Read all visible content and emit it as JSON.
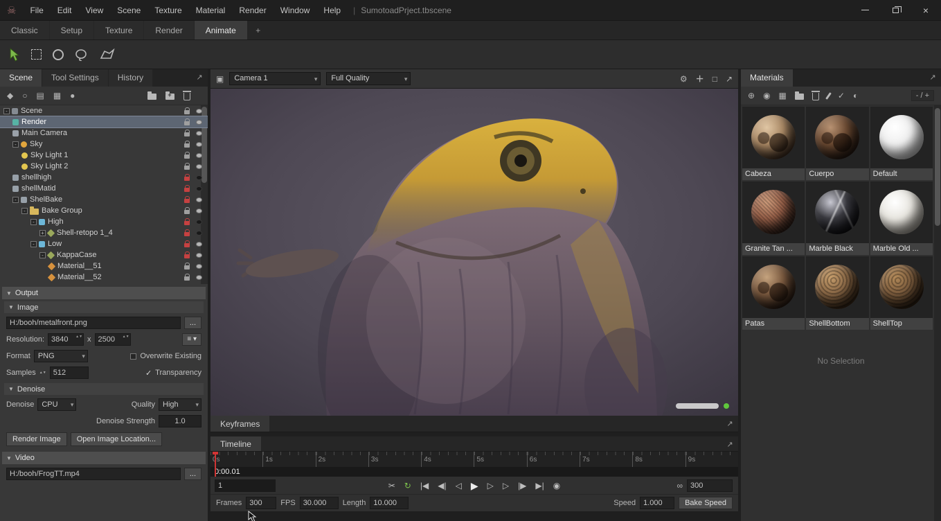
{
  "titlebar": {
    "menu": [
      "File",
      "Edit",
      "View",
      "Scene",
      "Texture",
      "Material",
      "Render",
      "Window",
      "Help"
    ],
    "separator": "|",
    "document": "SumotoadPrject.tbscene"
  },
  "workspace_tabs": {
    "items": [
      "Classic",
      "Setup",
      "Texture",
      "Render",
      "Animate"
    ],
    "active": "Animate",
    "add_button": "+"
  },
  "left_panel": {
    "tabs": [
      "Scene",
      "Tool Settings",
      "History"
    ],
    "active_tab": "Scene",
    "toolbar_icons": [
      {
        "n": "add-object-icon",
        "g": "◆"
      },
      {
        "n": "add-light-icon",
        "g": "○"
      },
      {
        "n": "add-backdrop-icon",
        "g": "▤"
      },
      {
        "n": "add-external-object-icon",
        "g": "▦"
      },
      {
        "n": "add-turntable-icon",
        "g": "●"
      },
      {
        "n": "new-folder-icon",
        "g": "folder"
      },
      {
        "n": "add-to-folder-icon",
        "g": "folder+"
      },
      {
        "n": "delete-object-icon",
        "g": "trash"
      }
    ],
    "tree": [
      {
        "l": "Scene",
        "d": 0,
        "c": "#858b92",
        "s": "sq",
        "exp": "-",
        "lock": "g",
        "eye": 1
      },
      {
        "l": "Render",
        "d": 1,
        "c": "#57b3a5",
        "s": "sq",
        "lock": "g",
        "eye": 1,
        "sel": true
      },
      {
        "l": "Main Camera",
        "d": 1,
        "c": "#9aa1a9",
        "s": "sq",
        "lock": "g",
        "eye": 1
      },
      {
        "l": "Sky",
        "d": 1,
        "c": "#e2a63d",
        "s": "ci",
        "exp": "-",
        "lock": "g",
        "eye": 1
      },
      {
        "l": "Sky Light 1",
        "d": 2,
        "c": "#e3c64f",
        "s": "ci",
        "lock": "g",
        "eye": 1
      },
      {
        "l": "Sky Light 2",
        "d": 2,
        "c": "#e3c64f",
        "s": "ci",
        "lock": "g",
        "eye": 1
      },
      {
        "l": "shellhigh",
        "d": 1,
        "c": "#97a0a8",
        "s": "sq",
        "lock": "r",
        "eye": 0
      },
      {
        "l": "shellMatid",
        "d": 1,
        "c": "#97a0a8",
        "s": "sq",
        "lock": "r",
        "eye": 0
      },
      {
        "l": "ShelBake",
        "d": 1,
        "c": "#97a0a8",
        "s": "sq",
        "exp": "-",
        "lock": "r",
        "eye": 1
      },
      {
        "l": "Bake Group",
        "d": 2,
        "c": "#d7b75c",
        "s": "folder",
        "exp": "-",
        "lock": "g",
        "eye": 1
      },
      {
        "l": "High",
        "d": 3,
        "c": "#6db7d8",
        "s": "sq",
        "exp": "-",
        "lock": "r",
        "eye": 0
      },
      {
        "l": "Shell-retopo 1_4",
        "d": 4,
        "c": "#9aa85c",
        "s": "di",
        "exp": "+",
        "lock": "r",
        "eye": 0
      },
      {
        "l": "Low",
        "d": 3,
        "c": "#6db7d8",
        "s": "sq",
        "exp": "-",
        "lock": "r",
        "eye": 1
      },
      {
        "l": "KappaCase",
        "d": 4,
        "c": "#9aa85c",
        "s": "di",
        "exp": "-",
        "lock": "r",
        "eye": 1
      },
      {
        "l": "Material__51",
        "d": 5,
        "c": "#d6913d",
        "s": "di",
        "lock": "g",
        "eye": 1
      },
      {
        "l": "Material__52",
        "d": 5,
        "c": "#d6913d",
        "s": "di",
        "lock": "g",
        "eye": 1
      }
    ],
    "output": {
      "header": "Output",
      "image": {
        "header": "Image",
        "path": "H:/booh/metalfront.png",
        "browse": "...",
        "resolution_label": "Resolution:",
        "width": "3840",
        "times": "x",
        "height": "2500",
        "preset_button": "≡ ▾",
        "format_label": "Format",
        "format": "PNG",
        "overwrite_label": "Overwrite Existing",
        "samples_label": "Samples",
        "samples": "512",
        "transparency_check": "✓",
        "transparency_label": "Transparency"
      },
      "denoise": {
        "header": "Denoise",
        "device_label": "Denoise",
        "device": "CPU",
        "quality_label": "Quality",
        "quality": "High",
        "strength_label": "Denoise Strength",
        "strength": "1.0"
      },
      "buttons": {
        "render": "Render Image",
        "open_location": "Open Image Location..."
      },
      "video": {
        "header": "Video",
        "path": "H:/booh/FrogTT.mp4",
        "browse": "..."
      }
    }
  },
  "viewport": {
    "camera_select": "Camera 1",
    "quality_select": "Full Quality"
  },
  "timeline": {
    "keyframes_label": "Keyframes",
    "timeline_label": "Timeline",
    "ticks": [
      "0s",
      "1s",
      "2s",
      "3s",
      "4s",
      "5s",
      "6s",
      "7s",
      "8s",
      "9s"
    ],
    "current_time": "0:00.01",
    "current_frame": "1",
    "loop_end": "300",
    "link_glyph": "∞",
    "transport": [
      {
        "n": "cut-keys-icon",
        "g": "✂"
      },
      {
        "n": "loop-playback-icon",
        "g": "↻",
        "c": "#7dc24c"
      },
      {
        "n": "jump-start-icon",
        "g": "|◀"
      },
      {
        "n": "prev-keyframe-icon",
        "g": "◀|"
      },
      {
        "n": "step-back-icon",
        "g": "◁"
      },
      {
        "n": "play-icon",
        "g": "▶",
        "big": true
      },
      {
        "n": "step-forward-icon",
        "g": "▷"
      },
      {
        "n": "play-realtime-icon",
        "g": "▷"
      },
      {
        "n": "next-keyframe-icon",
        "g": "|▶"
      },
      {
        "n": "jump-end-icon",
        "g": "▶|"
      },
      {
        "n": "render-preview-icon",
        "g": "◉"
      }
    ],
    "frames_label": "Frames",
    "frames": "300",
    "fps_label": "FPS",
    "fps": "30.000",
    "length_label": "Length",
    "length": "10.000",
    "speed_label": "Speed",
    "speed": "1.000",
    "bake_speed_button": "Bake Speed"
  },
  "materials": {
    "tab": "Materials",
    "zoom_control": "- / +",
    "toolbar_icons": [
      {
        "n": "add-material-icon",
        "g": "⊕"
      },
      {
        "n": "sphere-preview-icon",
        "g": "◉"
      },
      {
        "n": "checker-sphere-icon",
        "g": "▦"
      },
      {
        "n": "folder-icon",
        "g": "folder"
      },
      {
        "n": "delete-material-icon",
        "g": "trash"
      },
      {
        "n": "paint-brush-icon",
        "g": "brush"
      },
      {
        "n": "check-circle-icon",
        "g": "✓"
      },
      {
        "n": "globe-icon",
        "g": "◐"
      }
    ],
    "items": [
      {
        "name": "Cabeza",
        "kind": "patch",
        "hi": "#e0c6a4",
        "c1": "#ab8a66",
        "c2": "#38281d"
      },
      {
        "name": "Cuerpo",
        "kind": "patch",
        "hi": "#b89272",
        "c1": "#6b4a32",
        "c2": "#221711"
      },
      {
        "name": "Default",
        "kind": "plain",
        "hi": "#ffffff",
        "c1": "#f0f0f0",
        "c2": "#b4b4b4"
      },
      {
        "name": "Granite Tan ...",
        "kind": "stone",
        "hi": "#cf9d7c",
        "c1": "#965f48",
        "c2": "#2e1f19"
      },
      {
        "name": "Marble Black",
        "kind": "marble-dark",
        "hi": "#c8c8d2",
        "c1": "#3a3a40",
        "c2": "#0d0d10"
      },
      {
        "name": "Marble Old ...",
        "kind": "plain",
        "hi": "#ffffff",
        "c1": "#e9e7e1",
        "c2": "#98948c"
      },
      {
        "name": "Patas",
        "kind": "patch",
        "hi": "#c5a37e",
        "c1": "#7c5b40",
        "c2": "#241811"
      },
      {
        "name": "ShellBottom",
        "kind": "wood",
        "hi": "#c79e6c",
        "c1": "#8b6947",
        "c2": "#322315"
      },
      {
        "name": "ShellTop",
        "kind": "wood",
        "hi": "#b38a59",
        "c1": "#7d5d3e",
        "c2": "#281c11"
      }
    ],
    "empty_state": "No Selection"
  }
}
